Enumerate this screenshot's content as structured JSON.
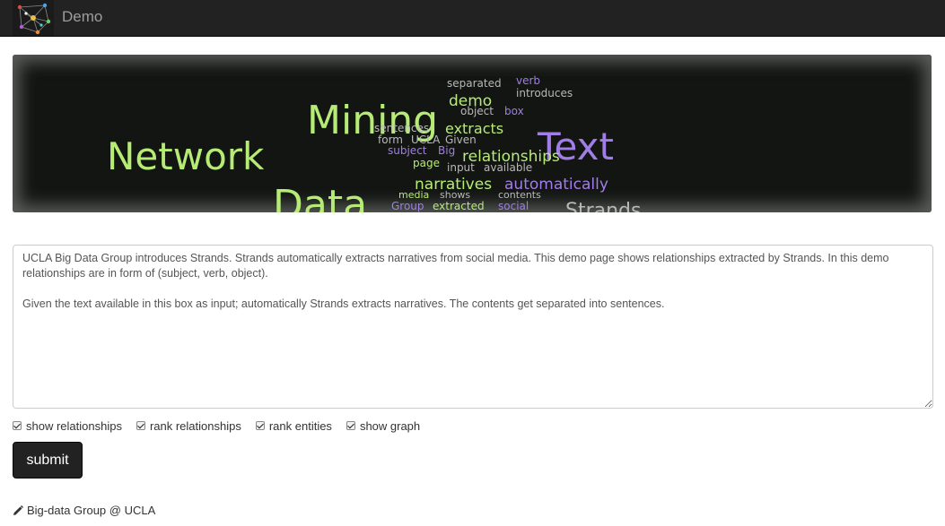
{
  "navbar": {
    "brand": "Demo"
  },
  "banner": {
    "words": [
      {
        "text": "Network",
        "color": "#b6ec75"
      },
      {
        "text": "Mining",
        "color": "#b6ec75"
      },
      {
        "text": "Data",
        "color": "#b6ec75"
      },
      {
        "text": "Text",
        "color": "#a17de8"
      },
      {
        "text": "Strands",
        "color": "#b8b8b8"
      },
      {
        "text": "separated",
        "color": "#b8b8b8"
      },
      {
        "text": "verb",
        "color": "#a17de8"
      },
      {
        "text": "introduces",
        "color": "#b8b8b8"
      },
      {
        "text": "demo",
        "color": "#b6ec75"
      },
      {
        "text": "object",
        "color": "#b8b8b8"
      },
      {
        "text": "box",
        "color": "#a17de8"
      },
      {
        "text": "sentences",
        "color": "#b8b8b8"
      },
      {
        "text": "extracts",
        "color": "#b6ec75"
      },
      {
        "text": "form",
        "color": "#b8b8b8"
      },
      {
        "text": "UCLA",
        "color": "#b8b8b8"
      },
      {
        "text": "Given",
        "color": "#b8b8b8"
      },
      {
        "text": "subject",
        "color": "#a17de8"
      },
      {
        "text": "Big",
        "color": "#a17de8"
      },
      {
        "text": "relationships",
        "color": "#b6ec75"
      },
      {
        "text": "page",
        "color": "#b6ec75"
      },
      {
        "text": "input",
        "color": "#b8b8b8"
      },
      {
        "text": "available",
        "color": "#b8b8b8"
      },
      {
        "text": "narratives",
        "color": "#b6ec75"
      },
      {
        "text": "automatically",
        "color": "#a17de8"
      },
      {
        "text": "media",
        "color": "#b6ec75"
      },
      {
        "text": "shows",
        "color": "#b8b8b8"
      },
      {
        "text": "contents",
        "color": "#b8b8b8"
      },
      {
        "text": "Group",
        "color": "#a17de8"
      },
      {
        "text": "extracted",
        "color": "#b6ec75"
      },
      {
        "text": "social",
        "color": "#a17de8"
      }
    ]
  },
  "input": {
    "value": "UCLA Big Data Group introduces Strands. Strands automatically extracts narratives from social media. This demo page shows relationships extracted by Strands. In this demo relationships are in form of (subject, verb, object).\n\nGiven the text available in this box as input; automatically Strands extracts narratives. The contents get separated into sentences."
  },
  "options": [
    {
      "label": "show relationships",
      "checked": true
    },
    {
      "label": "rank relationships",
      "checked": true
    },
    {
      "label": "rank entities",
      "checked": true
    },
    {
      "label": "show graph",
      "checked": true
    }
  ],
  "submit_label": "submit",
  "footer": {
    "icon": "pencil-icon",
    "text": "Big-data Group @ UCLA"
  }
}
